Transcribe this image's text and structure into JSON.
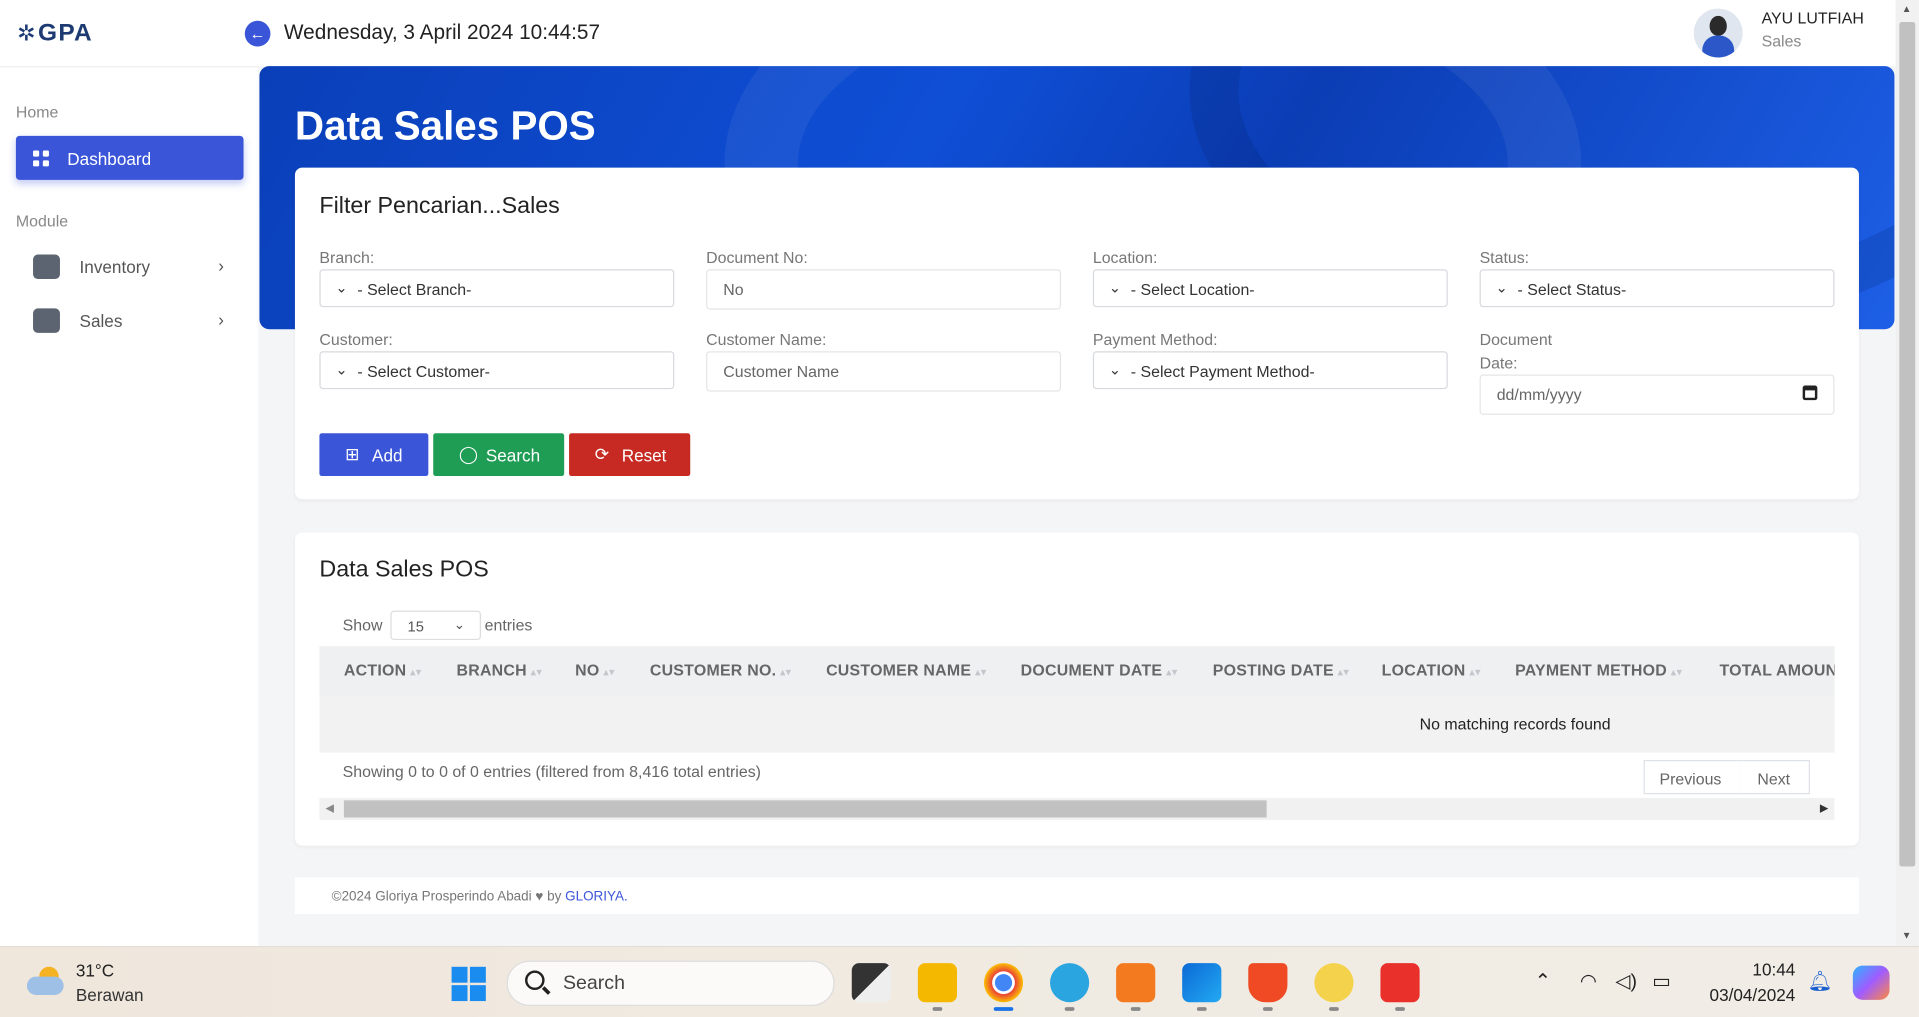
{
  "app": {
    "logo": "GPA"
  },
  "header": {
    "datetime": "Wednesday, 3 April 2024 10:44:57",
    "user_name": "AYU LUTFIAH",
    "user_role": "Sales"
  },
  "sidebar": {
    "section_home": "Home",
    "dashboard_label": "Dashboard",
    "section_module": "Module",
    "items": [
      {
        "label": "Inventory"
      },
      {
        "label": "Sales"
      }
    ]
  },
  "hero": {
    "title": "Data Sales POS"
  },
  "filter": {
    "title": "Filter Pencarian...Sales",
    "branch_label": "Branch:",
    "branch_value": "- Select Branch-",
    "docno_label": "Document No:",
    "docno_placeholder": "No",
    "location_label": "Location:",
    "location_value": "- Select Location-",
    "status_label": "Status:",
    "status_value": "- Select Status-",
    "customer_label": "Customer:",
    "customer_value": "- Select Customer-",
    "custname_label": "Customer Name:",
    "custname_placeholder": "Customer Name",
    "payment_label": "Payment Method:",
    "payment_value": "- Select Payment Method-",
    "docdate_label_1": "Document",
    "docdate_label_2": "Date:",
    "docdate_placeholder": "dd/mm/yyyy",
    "add_label": "Add",
    "search_label": "Search",
    "reset_label": "Reset"
  },
  "table": {
    "title": "Data Sales POS",
    "show_label": "Show",
    "page_length": "15",
    "entries_label": "entries",
    "columns": [
      "ACTION",
      "BRANCH",
      "NO",
      "CUSTOMER NO.",
      "CUSTOMER NAME",
      "DOCUMENT DATE",
      "POSTING DATE",
      "LOCATION",
      "PAYMENT METHOD",
      "TOTAL AMOUN"
    ],
    "empty_message": "No matching records found",
    "info": "Showing 0 to 0 of 0 entries (filtered from 8,416 total entries)",
    "prev_label": "Previous",
    "next_label": "Next"
  },
  "footer": {
    "copyright": "©2024 Gloriya Prosperindo Abadi",
    "by": "by",
    "brand": "GLORIYA."
  },
  "taskbar": {
    "temperature": "31°C",
    "condition": "Berawan",
    "search_label": "Search",
    "time": "10:44",
    "date": "03/04/2024"
  },
  "colors": {
    "primary": "#3b55d9",
    "success": "#1f9d55",
    "danger": "#c62a22",
    "hero": "#0f4fd6"
  }
}
